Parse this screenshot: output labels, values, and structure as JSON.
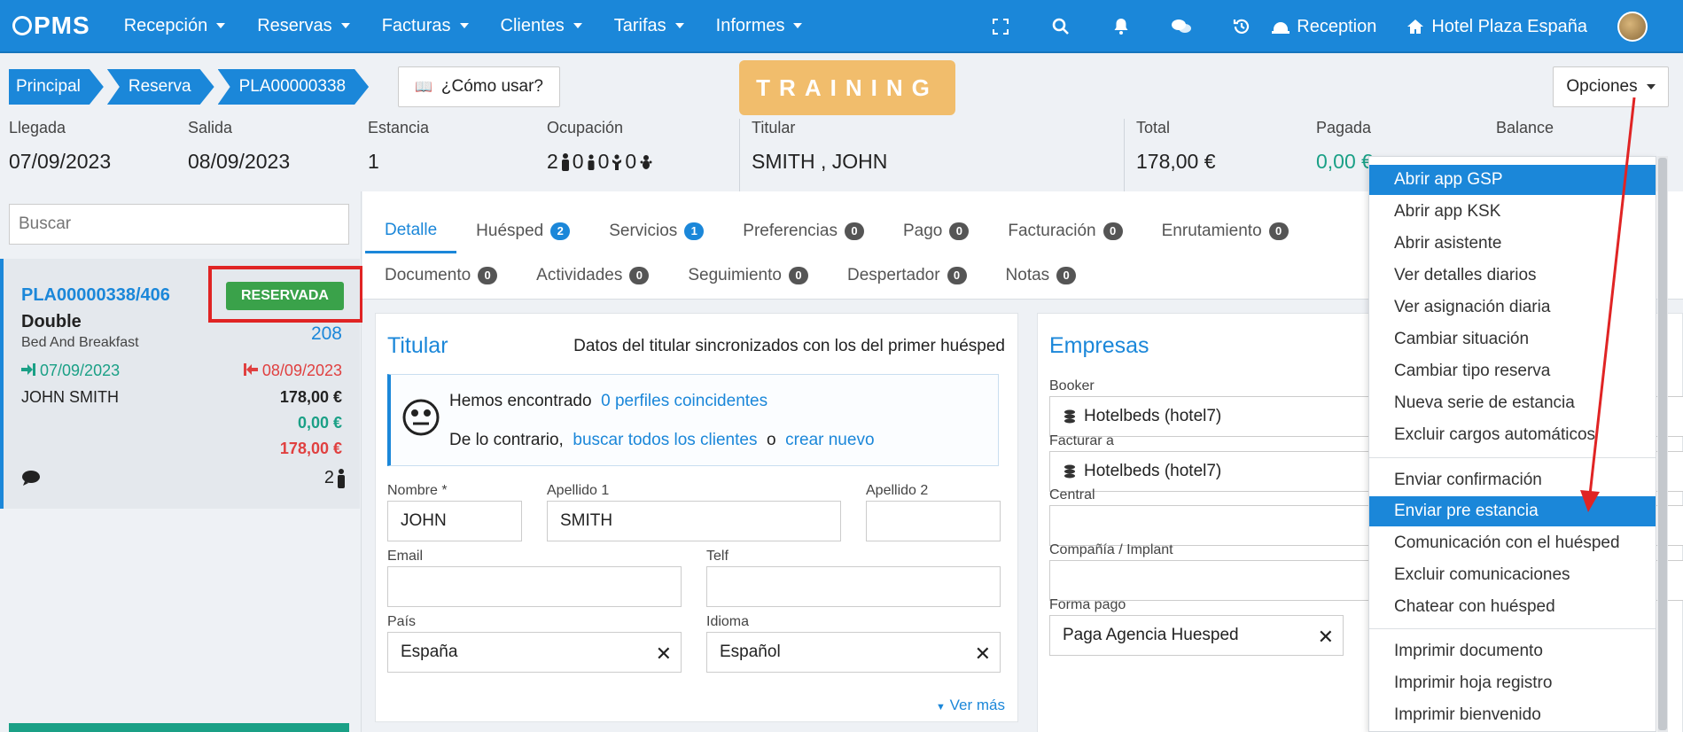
{
  "nav": {
    "logo": "PMS",
    "menu": [
      "Recepción",
      "Reservas",
      "Facturas",
      "Clientes",
      "Tarifas",
      "Informes"
    ],
    "reception": "Reception",
    "hotel": "Hotel Plaza España"
  },
  "breadcrumb": [
    "Principal",
    "Reserva",
    "PLA00000338"
  ],
  "howto": "¿Cómo usar?",
  "training": "TRAINING",
  "options": "Opciones",
  "header": {
    "llegada": {
      "label": "Llegada",
      "value": "07/09/2023"
    },
    "salida": {
      "label": "Salida",
      "value": "08/09/2023"
    },
    "estancia": {
      "label": "Estancia",
      "value": "1"
    },
    "ocupacion": {
      "label": "Ocupación",
      "values": [
        "2",
        "0",
        "0",
        "0"
      ]
    },
    "titular": {
      "label": "Titular",
      "value": "SMITH , JOHN"
    },
    "total": {
      "label": "Total",
      "value": "178,00 €"
    },
    "pagada": {
      "label": "Pagada",
      "value": "0,00 €"
    },
    "balance": {
      "label": "Balance",
      "value": ""
    }
  },
  "left": {
    "search_placeholder": "Buscar",
    "res": {
      "code": "PLA00000338/406",
      "status": "RESERVADA",
      "type": "Double",
      "room": "208",
      "board": "Bed And Breakfast",
      "checkin": "07/09/2023",
      "checkout": "08/09/2023",
      "guest": "JOHN SMITH",
      "amount_total": "178,00 €",
      "amount_paid": "0,00 €",
      "amount_pending": "178,00 €",
      "pax": "2"
    }
  },
  "tabs_row1": [
    {
      "label": "Detalle",
      "count": null
    },
    {
      "label": "Huésped",
      "count": "2"
    },
    {
      "label": "Servicios",
      "count": "1"
    },
    {
      "label": "Preferencias",
      "count": "0"
    },
    {
      "label": "Pago",
      "count": "0"
    },
    {
      "label": "Facturación",
      "count": "0"
    },
    {
      "label": "Enrutamiento",
      "count": "0"
    }
  ],
  "tabs_row2": [
    {
      "label": "Documento",
      "count": "0"
    },
    {
      "label": "Actividades",
      "count": "0"
    },
    {
      "label": "Seguimiento",
      "count": "0"
    },
    {
      "label": "Despertador",
      "count": "0"
    },
    {
      "label": "Notas",
      "count": "0"
    }
  ],
  "titular_panel": {
    "title": "Titular",
    "sync_note": "Datos del titular sincronizados con los del primer huésped",
    "found_text": "Hemos encontrado",
    "found_link": "0 perfiles coincidentes",
    "otherwise_text": "De lo contrario,",
    "search_all_link": "buscar todos los clientes",
    "or_text": "o",
    "create_link": "crear nuevo",
    "fields": {
      "nombre_label": "Nombre *",
      "nombre": "JOHN",
      "apellido1_label": "Apellido 1",
      "apellido1": "SMITH",
      "apellido2_label": "Apellido 2",
      "apellido2": "",
      "email_label": "Email",
      "email": "",
      "telf_label": "Telf",
      "telf": "",
      "pais_label": "País",
      "pais": "España",
      "idioma_label": "Idioma",
      "idioma": "Español"
    },
    "ver_mas": "Ver más"
  },
  "empresas_panel": {
    "title": "Empresas",
    "booker_label": "Booker",
    "booker": "Hotelbeds (hotel7)",
    "facturar_label": "Facturar a",
    "facturar": "Hotelbeds (hotel7)",
    "central_label": "Central",
    "central": "",
    "compania_label": "Compañía / Implant",
    "compania": "",
    "formapago_label": "Forma pago",
    "formapago": "Paga Agencia Huesped"
  },
  "dropdown": {
    "group1": [
      "Abrir app GSP",
      "Abrir app KSK",
      "Abrir asistente",
      "Ver detalles diarios",
      "Ver asignación diaria",
      "Cambiar situación",
      "Cambiar tipo reserva",
      "Nueva serie de estancia",
      "Excluir cargos automáticos"
    ],
    "group2": [
      "Enviar confirmación",
      "Enviar pre estancia",
      "Comunicación con el huésped",
      "Excluir comunicaciones",
      "Chatear con huésped"
    ],
    "group3": [
      "Imprimir documento",
      "Imprimir hoja registro",
      "Imprimir bienvenido"
    ]
  },
  "colors": {
    "brand": "#1b87d9",
    "training": "#f1bd6c",
    "status_green": "#3aa24a",
    "highlight_red": "#e02424",
    "teal": "#1aa086"
  }
}
